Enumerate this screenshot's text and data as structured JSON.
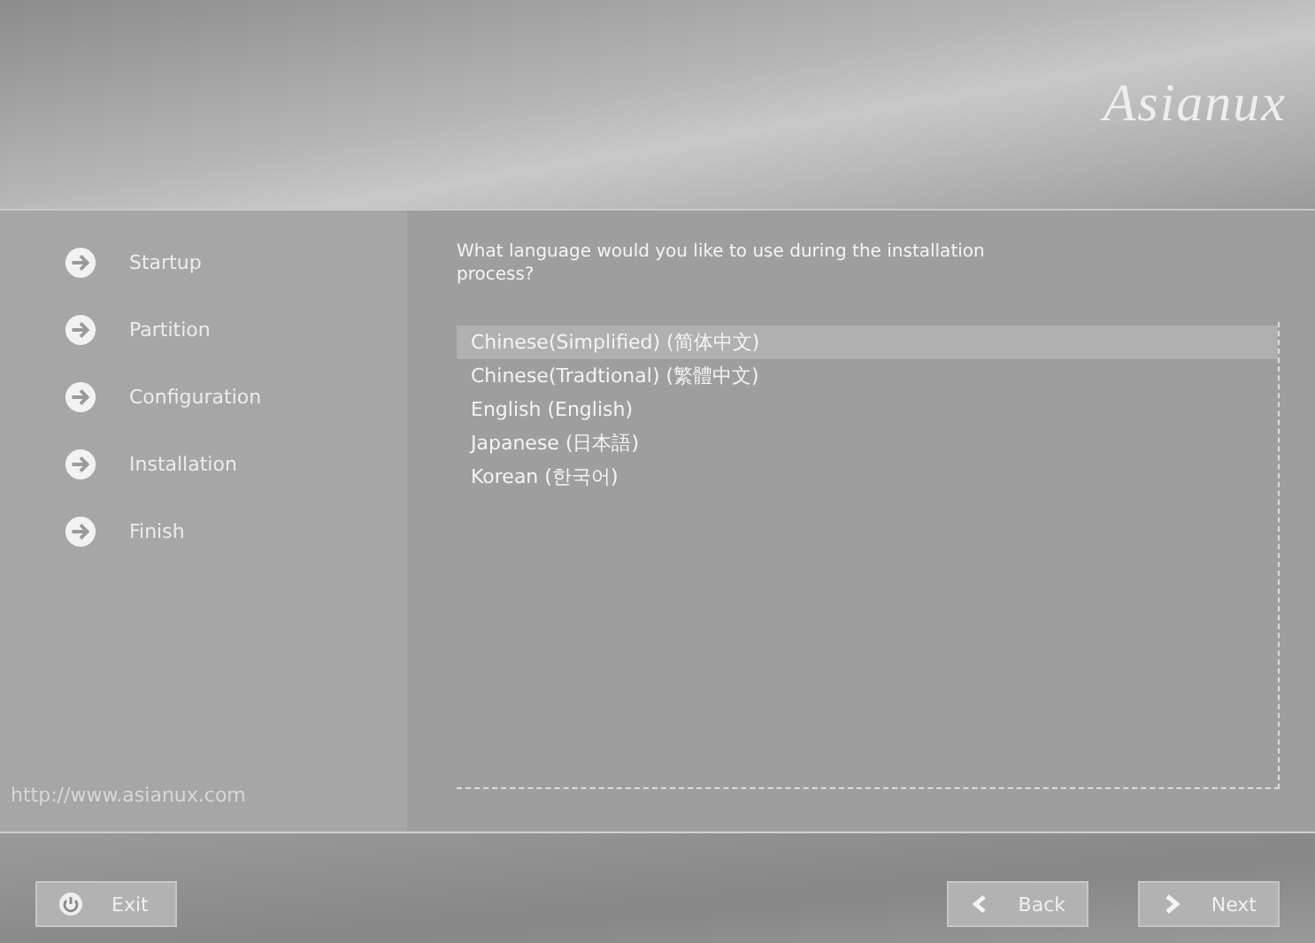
{
  "header": {
    "logo": "Asianux"
  },
  "steps": [
    {
      "label": "Startup"
    },
    {
      "label": "Partition"
    },
    {
      "label": "Configuration"
    },
    {
      "label": "Installation"
    },
    {
      "label": "Finish"
    }
  ],
  "website": "http://www.asianux.com",
  "question": "What language would you like to use during the installation process?",
  "languages": [
    {
      "label": "Chinese(Simplified) (简体中文)",
      "selected": true
    },
    {
      "label": "Chinese(Tradtional) (繁體中文)",
      "selected": false
    },
    {
      "label": "English (English)",
      "selected": false
    },
    {
      "label": "Japanese (日本語)",
      "selected": false
    },
    {
      "label": "Korean (한국어)",
      "selected": false
    }
  ],
  "buttons": {
    "exit": "Exit",
    "back": "Back",
    "next": "Next"
  }
}
